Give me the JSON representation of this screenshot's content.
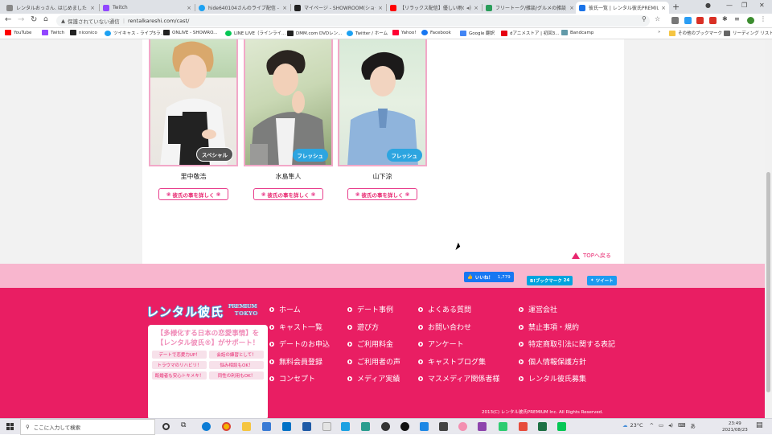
{
  "browser": {
    "tabs": [
      {
        "title": "レンタルおっさん. はじめました - 202",
        "color": "#888"
      },
      {
        "title": "Twitch",
        "color": "#9146ff"
      },
      {
        "title": "hide640104さんのライブ配信 - ツイ",
        "color": "#1da1f2"
      },
      {
        "title": "マイページ - SHOWROOM(ショール",
        "color": "#222"
      },
      {
        "title": "【リラックス配信】優しい雨の音",
        "color": "#ff0000"
      },
      {
        "title": "フリートーク/雑談/グルメの雑談・掲示",
        "color": "#2a9d5a"
      },
      {
        "title": "彼氏一覧 | レンタル彼氏PREMIUM",
        "color": "#1a73e8"
      }
    ],
    "new_tab": "+",
    "security_label": "保護されていない通信",
    "url": "rentalkareshi.com/cast/",
    "bookmarks": [
      {
        "label": "YouTube",
        "color": "#ff0000"
      },
      {
        "label": "Twitch",
        "color": "#9146ff"
      },
      {
        "label": "niconico",
        "color": "#222"
      },
      {
        "label": "ツイキャス - ライブ5ラ...",
        "color": "#1da1f2"
      },
      {
        "label": "ONLIVE - SHOWRO...",
        "color": "#222"
      },
      {
        "label": "LINE LIVE（ラインライ...",
        "color": "#06c755"
      },
      {
        "label": "DMM.com DVDレン...",
        "color": "#222"
      },
      {
        "label": "Twitter / ホーム",
        "color": "#1da1f2"
      },
      {
        "label": "Yahoo!",
        "color": "#ff0033"
      },
      {
        "label": "Facebook",
        "color": "#1877f2"
      },
      {
        "label": "Google 翻訳",
        "color": "#4285f4"
      },
      {
        "label": "dアニメストア | 初回3...",
        "color": "#e60012"
      },
      {
        "label": "Bandcamp",
        "color": "#629aa9"
      }
    ],
    "other_bookmarks": "その他のブックマーク",
    "reading_list": "リーディング リスト"
  },
  "casts": [
    {
      "name": "里中敬浩",
      "badge": "スペシャル",
      "badge_type": "special",
      "detail_label": "彼氏の事を詳しく"
    },
    {
      "name": "水島隼人",
      "badge": "フレッシュ",
      "badge_type": "fresh",
      "detail_label": "彼氏の事を詳しく"
    },
    {
      "name": "山下涼",
      "badge": "フレッシュ",
      "badge_type": "fresh",
      "detail_label": "彼氏の事を詳しく"
    }
  ],
  "top_link": "TOPへ戻る",
  "social": {
    "like_label": "いいね！",
    "like_count": "1,779",
    "hatena_label": "B!ブックマーク",
    "hatena_count": "24",
    "tweet_label": "ツイート"
  },
  "footer": {
    "logo_main": "レンタル彼氏",
    "logo_sub1": "PREMIUM",
    "logo_sub2": "TOKYO",
    "banner_line1": "【多様化する日本の恋愛事情】を",
    "banner_line2": "【レンタル彼氏®】がサポート！",
    "banner_pills": [
      "デートで恋愛力UP！",
      "会話の練習として！",
      "トラウマのリハビリ！",
      "悩み相談もOK！",
      "既婚者も安心トキメキ！",
      "同性の利用もOK！"
    ],
    "columns": [
      [
        "ホーム",
        "キャスト一覧",
        "デートのお申込",
        "無料会員登録",
        "コンセプト"
      ],
      [
        "デート事例",
        "遊び方",
        "ご利用料金",
        "ご利用者の声",
        "メディア実績"
      ],
      [
        "よくある質問",
        "お問い合わせ",
        "アンケート",
        "キャストブログ集",
        "マスメディア関係者様"
      ],
      [
        "運営会社",
        "禁止事項・規約",
        "特定商取引法に関する表記",
        "個人情報保護方針",
        "レンタル彼氏募集"
      ]
    ],
    "copyright": "2013(C) レンタル彼氏PREMIUM Inc. All Rights Reserved."
  },
  "taskbar": {
    "search_placeholder": "ここに入力して検索",
    "weather": "23°C",
    "ime": "あ",
    "time": "23:49",
    "date": "2021/08/23"
  },
  "colors": {
    "brand_pink": "#e91e63",
    "light_pink": "#f8b6ce",
    "photo_border": "#f2a8c8",
    "fresh_badge": "#2da5e0"
  }
}
